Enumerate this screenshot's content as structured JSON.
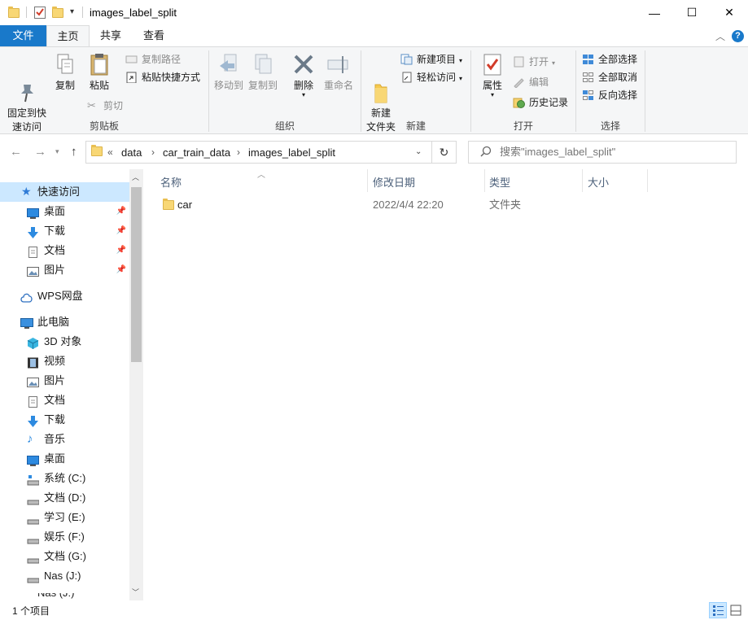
{
  "window": {
    "title": "images_label_split",
    "minimize": "—",
    "maximize": "☐",
    "close": "✕"
  },
  "ribbon_tabs": [
    "文件",
    "主页",
    "共享",
    "查看"
  ],
  "ribbon": {
    "clipboard": {
      "pin_label": "固定到快\n速访问",
      "copy": "复制",
      "paste": "粘贴",
      "copy_path": "复制路径",
      "paste_shortcut": "粘贴快捷方式",
      "cut": "剪切",
      "group_label": "剪贴板"
    },
    "organize": {
      "move_to": "移动到",
      "copy_to": "复制到",
      "delete": "删除",
      "rename": "重命名",
      "group_label": "组织"
    },
    "new": {
      "new_folder": "新建\n文件夹",
      "new_item": "新建项目",
      "easy_access": "轻松访问",
      "group_label": "新建"
    },
    "open": {
      "properties": "属性",
      "open": "打开",
      "edit": "编辑",
      "history": "历史记录",
      "group_label": "打开"
    },
    "select": {
      "select_all": "全部选择",
      "select_none": "全部取消",
      "invert": "反向选择",
      "group_label": "选择"
    }
  },
  "address": {
    "crumbs": [
      "data",
      "car_train_data",
      "images_label_split"
    ],
    "overflow": "«",
    "search_placeholder": "搜索\"images_label_split\""
  },
  "nav": {
    "quick_access": "快速访问",
    "qa_items": [
      "桌面",
      "下载",
      "文档",
      "图片"
    ],
    "wps": "WPS网盘",
    "this_pc": "此电脑",
    "pc_items": [
      "3D 对象",
      "视频",
      "图片",
      "文档",
      "下载",
      "音乐",
      "桌面",
      "系统 (C:)",
      "文档 (D:)",
      "学习 (E:)",
      "娱乐 (F:)",
      "文档 (G:)",
      "Nas (J:)"
    ],
    "partial_item": "Nas (J:)"
  },
  "columns": {
    "name": "名称",
    "date": "修改日期",
    "type": "类型",
    "size": "大小"
  },
  "files": [
    {
      "name": "car",
      "date": "2022/4/4 22:20",
      "type": "文件夹",
      "size": ""
    }
  ],
  "status": {
    "count": "1 个项目"
  },
  "colors": {
    "accent": "#1979ca",
    "selection": "#cce8ff",
    "folder": "#f8d775"
  }
}
